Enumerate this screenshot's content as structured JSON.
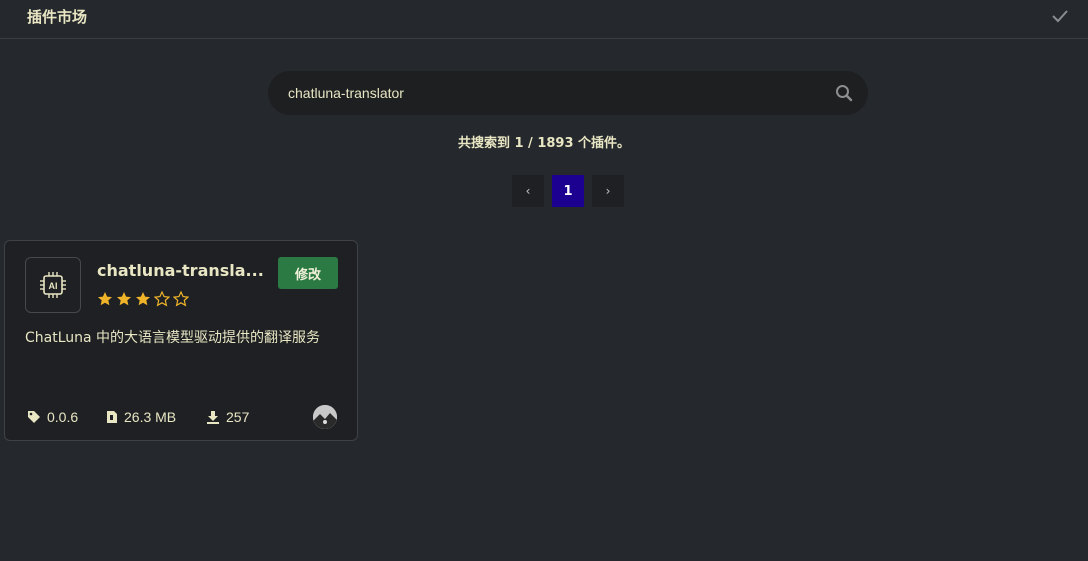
{
  "header": {
    "title": "插件市场",
    "check_icon": "check-icon"
  },
  "search": {
    "value": "chatluna-translator",
    "placeholder": "",
    "icon": "search-icon"
  },
  "result_count": "共搜索到 1 / 1893 个插件。",
  "pagination": {
    "prev": "‹",
    "current_page": "1",
    "next": "›"
  },
  "plugin_card": {
    "name": "chatluna-transla...",
    "icon": "ai-chip-icon",
    "rating": 3,
    "rating_max": 5,
    "action_label": "修改",
    "description": "ChatLuna 中的大语言模型驱动提供的翻译服务",
    "version": "0.0.6",
    "size": "26.3 MB",
    "downloads": "257"
  },
  "colors": {
    "background": "#25282c",
    "card": "#1e2023",
    "accent_green": "#2b7a43",
    "page_active": "#1c0090",
    "star": "#f0b42a",
    "text": "#e8e6c3"
  }
}
